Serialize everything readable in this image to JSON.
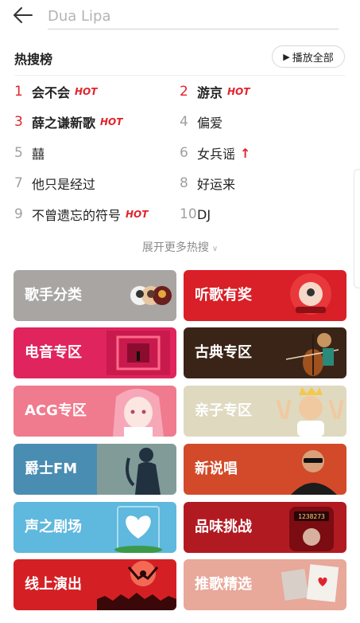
{
  "search": {
    "placeholder": "Dua Lipa"
  },
  "hot_search": {
    "title": "热搜榜",
    "play_all_label": "播放全部",
    "items": [
      {
        "rank": "1",
        "name": "会不会",
        "badge": "HOT"
      },
      {
        "rank": "2",
        "name": "游京",
        "badge": "HOT"
      },
      {
        "rank": "3",
        "name": "薛之谦新歌",
        "badge": "HOT"
      },
      {
        "rank": "4",
        "name": "偏爱",
        "badge": ""
      },
      {
        "rank": "5",
        "name": "囍",
        "badge": ""
      },
      {
        "rank": "6",
        "name": "女兵谣",
        "badge": "↑"
      },
      {
        "rank": "7",
        "name": "他只是经过",
        "badge": ""
      },
      {
        "rank": "8",
        "name": "好运来",
        "badge": ""
      },
      {
        "rank": "9",
        "name": "不曾遗忘的符号",
        "badge": "HOT"
      },
      {
        "rank": "10",
        "name": "DJ",
        "badge": ""
      }
    ],
    "expand_label": "展开更多热搜"
  },
  "categories": [
    {
      "label": "歌手分类",
      "color": "#a9a5a2"
    },
    {
      "label": "听歌有奖",
      "color": "#d91f27"
    },
    {
      "label": "电音专区",
      "color": "#e0245e"
    },
    {
      "label": "古典专区",
      "color": "#3a2418"
    },
    {
      "label": "ACG专区",
      "color": "#f07a8e"
    },
    {
      "label": "亲子专区",
      "color": "#dfd9c0"
    },
    {
      "label": "爵士FM",
      "color": "#4a8db2"
    },
    {
      "label": "新说唱",
      "color": "#d24a2a"
    },
    {
      "label": "声之剧场",
      "color": "#5fb8dd"
    },
    {
      "label": "品味挑战",
      "color": "#b21a22"
    },
    {
      "label": "线上演出",
      "color": "#d42024"
    },
    {
      "label": "推歌精选",
      "color": "#e8a89a"
    }
  ],
  "colors": {
    "accent": "#e0242c"
  }
}
